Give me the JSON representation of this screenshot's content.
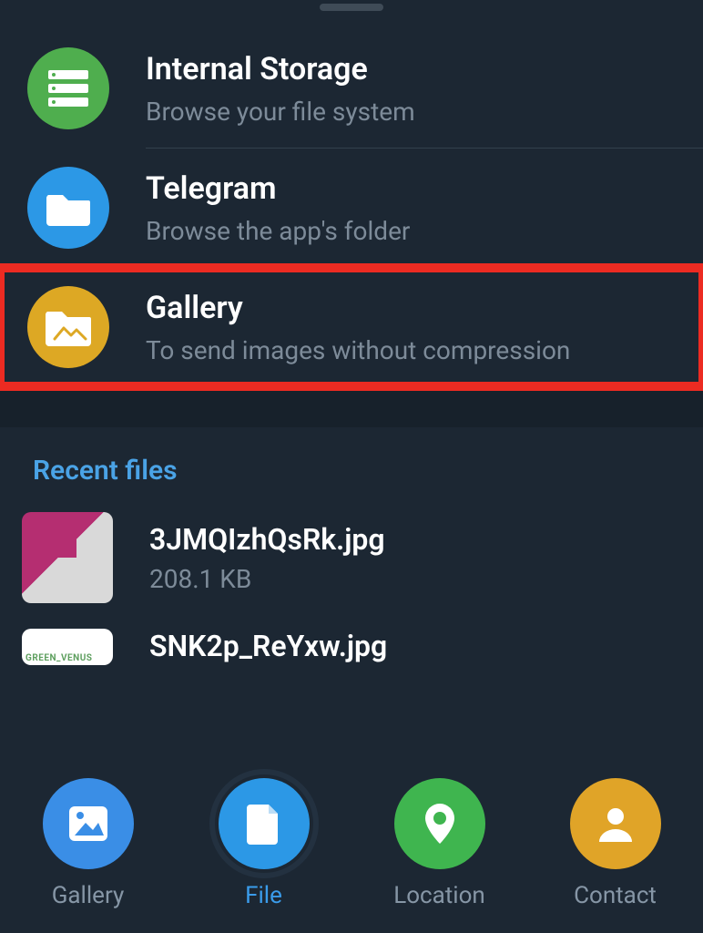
{
  "storage": [
    {
      "title": "Internal Storage",
      "subtitle": "Browse your file system",
      "icon": "storage-icon",
      "color": "c-green"
    },
    {
      "title": "Telegram",
      "subtitle": "Browse the app's folder",
      "icon": "folder-icon",
      "color": "c-blue"
    },
    {
      "title": "Gallery",
      "subtitle": "To send images without compression",
      "icon": "image-folder-icon",
      "color": "c-yellow",
      "highlight": true
    }
  ],
  "recent": {
    "header": "Recent files",
    "items": [
      {
        "name": "3JMQIzhQsRk.jpg",
        "size": "208.1 KB"
      },
      {
        "name": "SNK2p_ReYxw.jpg",
        "size": ""
      }
    ]
  },
  "tabs": [
    {
      "label": "Gallery",
      "icon": "image-icon",
      "color": "c-blue2",
      "active": false
    },
    {
      "label": "File",
      "icon": "file-icon",
      "color": "c-blue",
      "active": true
    },
    {
      "label": "Location",
      "icon": "location-icon",
      "color": "c-green2",
      "active": false
    },
    {
      "label": "Contact",
      "icon": "contact-icon",
      "color": "c-orange",
      "active": false
    }
  ],
  "colors": {
    "accent": "#3a9ceb",
    "highlight_border": "#ec2b22"
  }
}
